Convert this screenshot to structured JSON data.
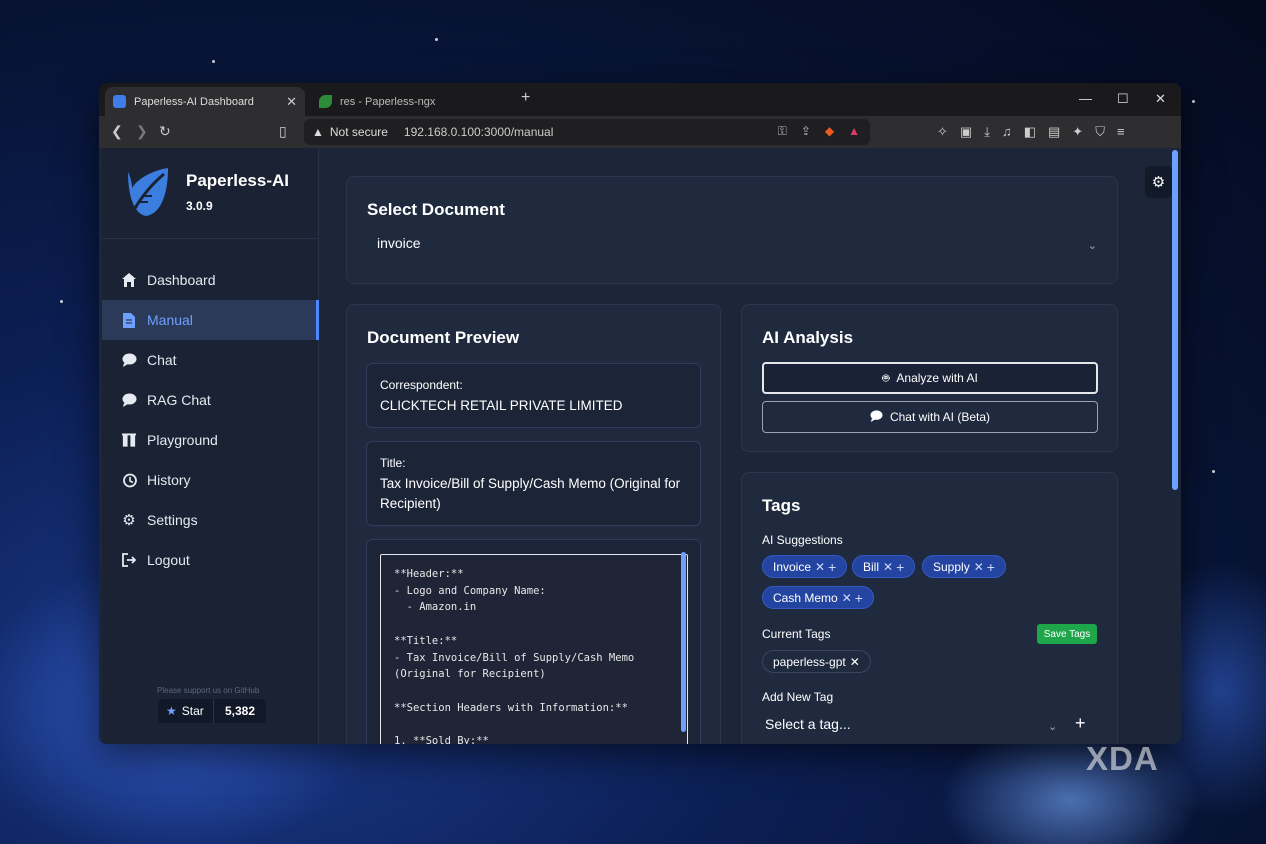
{
  "browser": {
    "tabs": [
      {
        "title": "Paperless-AI Dashboard",
        "active": true
      },
      {
        "title": "res - Paperless-ngx",
        "active": false
      }
    ],
    "security": "Not secure",
    "url": "192.168.0.100:3000/manual"
  },
  "sidebar": {
    "app_name": "Paperless-AI",
    "version": "3.0.9",
    "items": [
      {
        "label": "Dashboard",
        "icon": "home-icon"
      },
      {
        "label": "Manual",
        "icon": "document-icon",
        "active": true
      },
      {
        "label": "Chat",
        "icon": "chat-icon"
      },
      {
        "label": "RAG Chat",
        "icon": "chat-icon"
      },
      {
        "label": "Playground",
        "icon": "flask-icon"
      },
      {
        "label": "History",
        "icon": "history-icon"
      },
      {
        "label": "Settings",
        "icon": "gear-icon"
      },
      {
        "label": "Logout",
        "icon": "logout-icon"
      }
    ],
    "support_text": "Please support us on GitHub",
    "star_label": "Star",
    "star_count": "5,382"
  },
  "select_document": {
    "title": "Select Document",
    "value": "invoice"
  },
  "preview": {
    "title": "Document Preview",
    "correspondent_label": "Correspondent:",
    "correspondent_value": "CLICKTECH RETAIL PRIVATE LIMITED",
    "title_label": "Title:",
    "title_value": "Tax Invoice/Bill of Supply/Cash Memo (Original for Recipient)",
    "content": "**Header:**\n- Logo and Company Name:\n  - Amazon.in\n\n**Title:**\n- Tax Invoice/Bill of Supply/Cash Memo\n(Original for Recipient)\n\n**Section Headers with Information:**\n\n1. **Sold By:**"
  },
  "ai_analysis": {
    "title": "AI Analysis",
    "analyze_label": "Analyze with AI",
    "chat_label": "Chat with AI (Beta)"
  },
  "tags": {
    "title": "Tags",
    "suggestions_label": "AI Suggestions",
    "suggestions": [
      "Invoice",
      "Bill",
      "Supply",
      "Cash Memo"
    ],
    "current_label": "Current Tags",
    "save_label": "Save Tags",
    "current": [
      "paperless-gpt"
    ],
    "add_label": "Add New Tag",
    "select_placeholder": "Select a tag..."
  },
  "watermark": "XDA",
  "colors": {
    "accent": "#4a88ff",
    "pill": "#2344a0",
    "save": "#1fa54a",
    "panel": "#1f2a3e"
  }
}
